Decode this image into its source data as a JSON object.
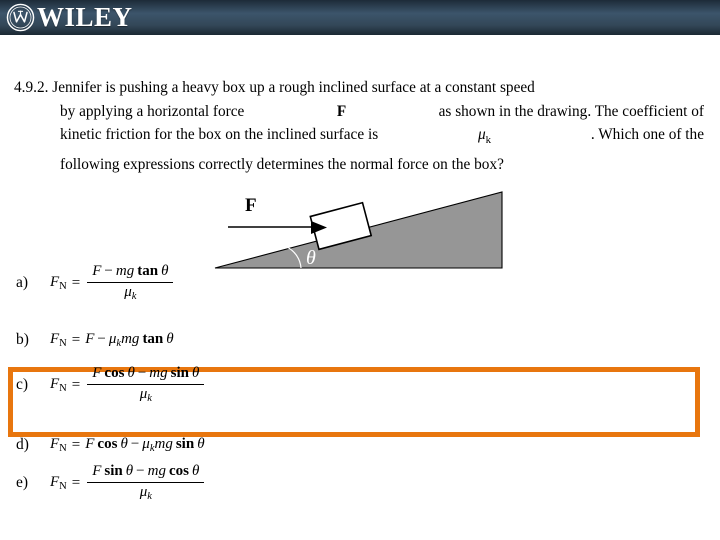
{
  "header": {
    "brand": "WILEY",
    "logo_icon": "wiley-circle-monogram-icon",
    "bg_start": "#1d2b38",
    "bg_mid": "#3c556b",
    "bg_end": "#1b2833"
  },
  "question": {
    "number": "4.9.2.",
    "line1_left": "4.9.2. Jennifer is pushing a heavy box up a rough inclined surface at a constant speed",
    "line2_a": "by applying a horizontal force",
    "line2_force": "F",
    "line2_b": "as shown in the drawing.   The coefficient of",
    "line3_a": "kinetic friction for the box on the inclined surface is",
    "line3_mu": "μ",
    "line3_mu_sub": "k",
    "line3_b": ".   Which one of the",
    "line4": "following expressions correctly determines the normal force on the box?"
  },
  "figure": {
    "name": "inclined-plane-diagram",
    "force_label": "F",
    "angle_label": "θ",
    "incline_fill": "#969696",
    "box_fill": "#ffffff",
    "outline": "#000000",
    "angle_label_color": "#ffffff"
  },
  "options": [
    {
      "letter": "a)",
      "name": "option-a",
      "form": "fraction",
      "lhs": "F",
      "lhs_sub": "N",
      "numerator": [
        {
          "t": "F",
          "s": "it"
        },
        {
          "t": "−",
          "s": "op"
        },
        {
          "t": "mg",
          "s": "it"
        },
        {
          "t": " ",
          "s": "sp"
        },
        {
          "t": "tan",
          "s": "bf"
        },
        {
          "t": " ",
          "s": "sp"
        },
        {
          "t": "θ",
          "s": "it"
        }
      ],
      "denominator": [
        {
          "t": "μ",
          "s": "it"
        },
        {
          "t": "k",
          "s": "it-sub"
        }
      ],
      "highlighted": false
    },
    {
      "letter": "b)",
      "name": "option-b",
      "form": "inline",
      "lhs": "F",
      "lhs_sub": "N",
      "expr": [
        {
          "t": "F",
          "s": "it"
        },
        {
          "t": "−",
          "s": "op"
        },
        {
          "t": "μ",
          "s": "it"
        },
        {
          "t": "k",
          "s": "it-sub"
        },
        {
          "t": "mg",
          "s": "it"
        },
        {
          "t": " ",
          "s": "sp"
        },
        {
          "t": "tan",
          "s": "bf"
        },
        {
          "t": " ",
          "s": "sp"
        },
        {
          "t": "θ",
          "s": "it"
        }
      ],
      "highlighted": false
    },
    {
      "letter": "c)",
      "name": "option-c",
      "form": "fraction",
      "lhs": "F",
      "lhs_sub": "N",
      "numerator": [
        {
          "t": "F",
          "s": "it"
        },
        {
          "t": " ",
          "s": "sp"
        },
        {
          "t": "cos",
          "s": "bf"
        },
        {
          "t": " ",
          "s": "sp"
        },
        {
          "t": "θ",
          "s": "it"
        },
        {
          "t": "−",
          "s": "op"
        },
        {
          "t": "mg",
          "s": "it"
        },
        {
          "t": " ",
          "s": "sp"
        },
        {
          "t": "sin",
          "s": "bf"
        },
        {
          "t": " ",
          "s": "sp"
        },
        {
          "t": "θ",
          "s": "it"
        }
      ],
      "denominator": [
        {
          "t": "μ",
          "s": "it"
        },
        {
          "t": "k",
          "s": "it-sub"
        }
      ],
      "highlighted": true
    },
    {
      "letter": "d)",
      "name": "option-d",
      "form": "inline",
      "lhs": "F",
      "lhs_sub": "N",
      "expr": [
        {
          "t": "F",
          "s": "it"
        },
        {
          "t": " ",
          "s": "sp"
        },
        {
          "t": "cos",
          "s": "bf"
        },
        {
          "t": " ",
          "s": "sp"
        },
        {
          "t": "θ",
          "s": "it"
        },
        {
          "t": "−",
          "s": "op"
        },
        {
          "t": "μ",
          "s": "it"
        },
        {
          "t": "k",
          "s": "it-sub"
        },
        {
          "t": "mg",
          "s": "it"
        },
        {
          "t": " ",
          "s": "sp"
        },
        {
          "t": "sin",
          "s": "bf"
        },
        {
          "t": " ",
          "s": "sp"
        },
        {
          "t": "θ",
          "s": "it"
        }
      ],
      "highlighted": false
    },
    {
      "letter": "e)",
      "name": "option-e",
      "form": "fraction",
      "lhs": "F",
      "lhs_sub": "N",
      "numerator": [
        {
          "t": "F",
          "s": "it"
        },
        {
          "t": " ",
          "s": "sp"
        },
        {
          "t": "sin",
          "s": "bf"
        },
        {
          "t": " ",
          "s": "sp"
        },
        {
          "t": "θ",
          "s": "it"
        },
        {
          "t": "−",
          "s": "op"
        },
        {
          "t": "mg",
          "s": "it"
        },
        {
          "t": " ",
          "s": "sp"
        },
        {
          "t": "cos",
          "s": "bf"
        },
        {
          "t": " ",
          "s": "sp"
        },
        {
          "t": "θ",
          "s": "it"
        }
      ],
      "denominator": [
        {
          "t": "μ",
          "s": "it"
        },
        {
          "t": "k",
          "s": "it-sub"
        }
      ],
      "highlighted": false
    }
  ],
  "highlight": {
    "color": "#E8760E",
    "target": "option-c"
  },
  "equals_sign": "="
}
